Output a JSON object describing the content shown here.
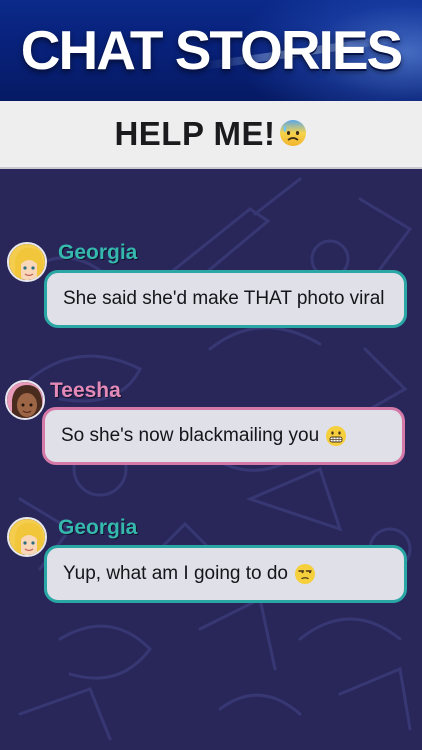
{
  "header": {
    "app_title": "CHAT STORIES"
  },
  "story": {
    "title": "HELP ME!",
    "title_emoji": "anxious-face-with-sweat-icon"
  },
  "colors": {
    "banner": "#08217a",
    "chat_background": "#29275a",
    "georgia_accent": "#2aa7a5",
    "teesha_accent": "#d57aa8",
    "bubble_fill": "#dfe0e8"
  },
  "messages": [
    {
      "sender": "Georgia",
      "text": "She said she'd make THAT photo viral",
      "avatar": "blonde-girl-avatar",
      "emoji": null
    },
    {
      "sender": "Teesha",
      "text": "So she's now blackmailing you",
      "avatar": "brunette-girl-avatar",
      "emoji": "grimacing-face-icon"
    },
    {
      "sender": "Georgia",
      "text": "Yup, what am I going to do",
      "avatar": "blonde-girl-avatar",
      "emoji": "unamused-face-icon"
    }
  ]
}
